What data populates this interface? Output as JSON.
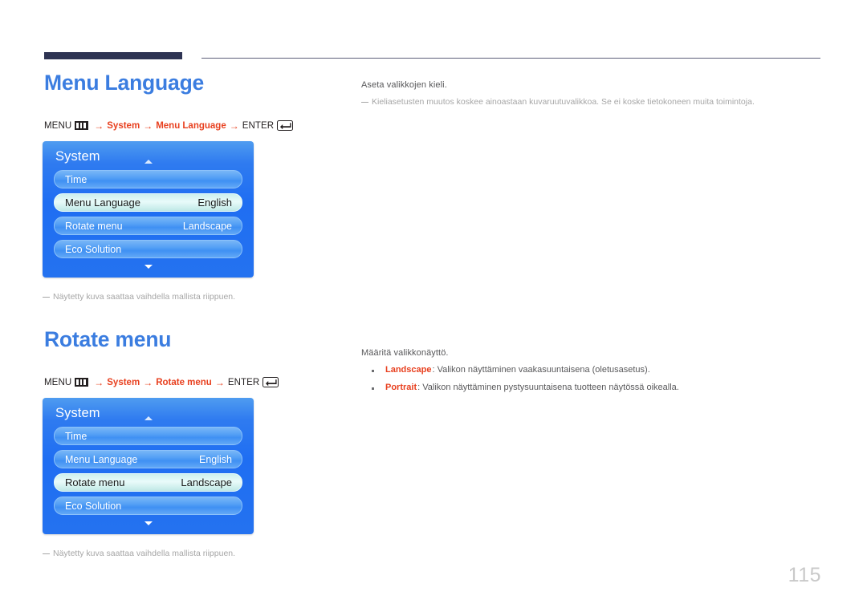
{
  "page": {
    "number": "115"
  },
  "sections": [
    {
      "id": "menu-language",
      "heading": "Menu Language",
      "breadcrumb": {
        "menu_label": "MENU",
        "menu_icon": "menu-bars-icon",
        "arrow": "→",
        "crumb1": "System",
        "crumb2": "Menu Language",
        "enter_label": "ENTER",
        "enter_icon": "enter-return-icon"
      },
      "osd": {
        "title": "System",
        "scroll_up_icon": "triangle-up-icon",
        "scroll_down_icon": "triangle-down-icon",
        "rows": [
          {
            "label": "Time",
            "value": "",
            "selected": false
          },
          {
            "label": "Menu Language",
            "value": "English",
            "selected": true
          },
          {
            "label": "Rotate menu",
            "value": "Landscape",
            "selected": false
          },
          {
            "label": "Eco Solution",
            "value": "",
            "selected": false
          }
        ]
      },
      "caption": "Näytetty kuva saattaa vaihdella mallista riippuen.",
      "right": {
        "lead": "Aseta valikkojen kieli.",
        "note": "Kieliasetusten muutos koskee ainoastaan kuvaruutuvalikkoa. Se ei koske tietokoneen muita toimintoja.",
        "bullets": []
      }
    },
    {
      "id": "rotate-menu",
      "heading": "Rotate menu",
      "breadcrumb": {
        "menu_label": "MENU",
        "menu_icon": "menu-bars-icon",
        "arrow": "→",
        "crumb1": "System",
        "crumb2": "Rotate menu",
        "enter_label": "ENTER",
        "enter_icon": "enter-return-icon"
      },
      "osd": {
        "title": "System",
        "scroll_up_icon": "triangle-up-icon",
        "scroll_down_icon": "triangle-down-icon",
        "rows": [
          {
            "label": "Time",
            "value": "",
            "selected": false
          },
          {
            "label": "Menu Language",
            "value": "English",
            "selected": false
          },
          {
            "label": "Rotate menu",
            "value": "Landscape",
            "selected": true
          },
          {
            "label": "Eco Solution",
            "value": "",
            "selected": false
          }
        ]
      },
      "caption": "Näytetty kuva saattaa vaihdella mallista riippuen.",
      "right": {
        "lead": "Määritä valikkonäyttö.",
        "note": "",
        "bullets": [
          {
            "term": "Landscape",
            "text": ": Valikon näyttäminen vaakasuuntaisena (oletusasetus)."
          },
          {
            "term": "Portrait",
            "text": ": Valikon näyttäminen pystysuuntaisena tuotteen näytössä oikealla."
          }
        ]
      }
    }
  ],
  "colors": {
    "heading": "#3b7de0",
    "accent": "#e8401f",
    "rule_dark": "#2e3453",
    "osd_blue": "#1f6ef2",
    "osd_selected": "#d6f2f0"
  }
}
